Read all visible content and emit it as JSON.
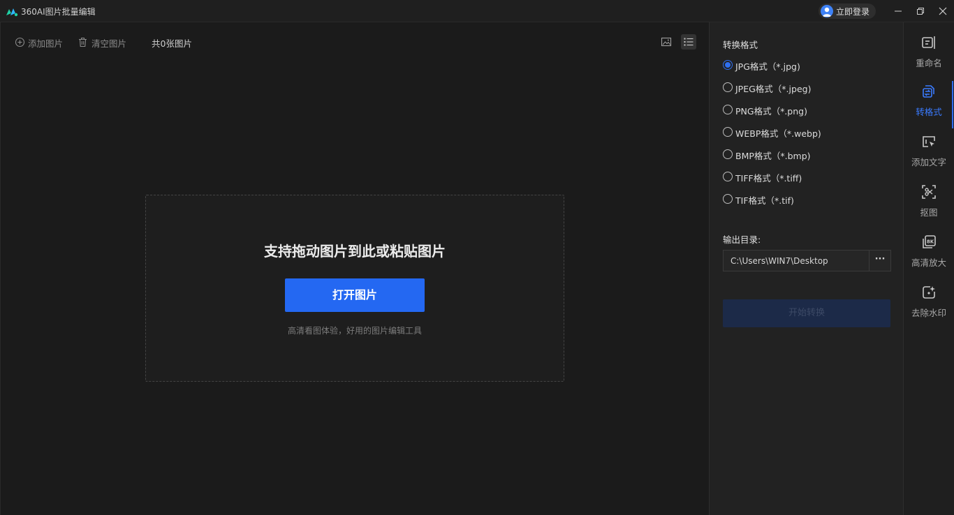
{
  "app": {
    "title": "360AI图片批量编辑",
    "login_label": "立即登录"
  },
  "window_controls": [
    "minimize-icon",
    "restore-icon",
    "close-icon"
  ],
  "toolbar": {
    "add_label": "添加图片",
    "clear_label": "清空图片",
    "count_label": "共0张图片",
    "view_modes": [
      "thumbnail-view-icon",
      "list-view-icon"
    ],
    "active_view": "list"
  },
  "dropzone": {
    "title": "支持拖动图片到此或粘贴图片",
    "open_label": "打开图片",
    "subtitle": "高清看图体验，好用的图片编辑工具"
  },
  "panel": {
    "heading": "转换格式",
    "formats": [
      {
        "label": "JPG格式（*.jpg)",
        "checked": true
      },
      {
        "label": "JPEG格式（*.jpeg)",
        "checked": false
      },
      {
        "label": "PNG格式（*.png)",
        "checked": false
      },
      {
        "label": "WEBP格式（*.webp)",
        "checked": false
      },
      {
        "label": "BMP格式（*.bmp)",
        "checked": false
      },
      {
        "label": "TIFF格式（*.tiff)",
        "checked": false
      },
      {
        "label": "TIF格式（*.tif)",
        "checked": false
      }
    ],
    "output_label": "输出目录:",
    "output_path": "C:\\Users\\WIN7\\Desktop",
    "browse_label": "···",
    "start_label": "开始转换"
  },
  "rail": {
    "active": "转格式",
    "items": [
      {
        "label": "重命名",
        "icon": "rename-icon"
      },
      {
        "label": "转格式",
        "icon": "convert-format-icon"
      },
      {
        "label": "添加文字",
        "icon": "add-text-icon"
      },
      {
        "label": "抠图",
        "icon": "cutout-icon"
      },
      {
        "label": "高清放大",
        "icon": "upscale-8k-icon"
      },
      {
        "label": "去除水印",
        "icon": "remove-watermark-icon"
      }
    ]
  },
  "colors": {
    "accent": "#2468f2",
    "background": "#1b1b1b",
    "panel": "#222222"
  }
}
